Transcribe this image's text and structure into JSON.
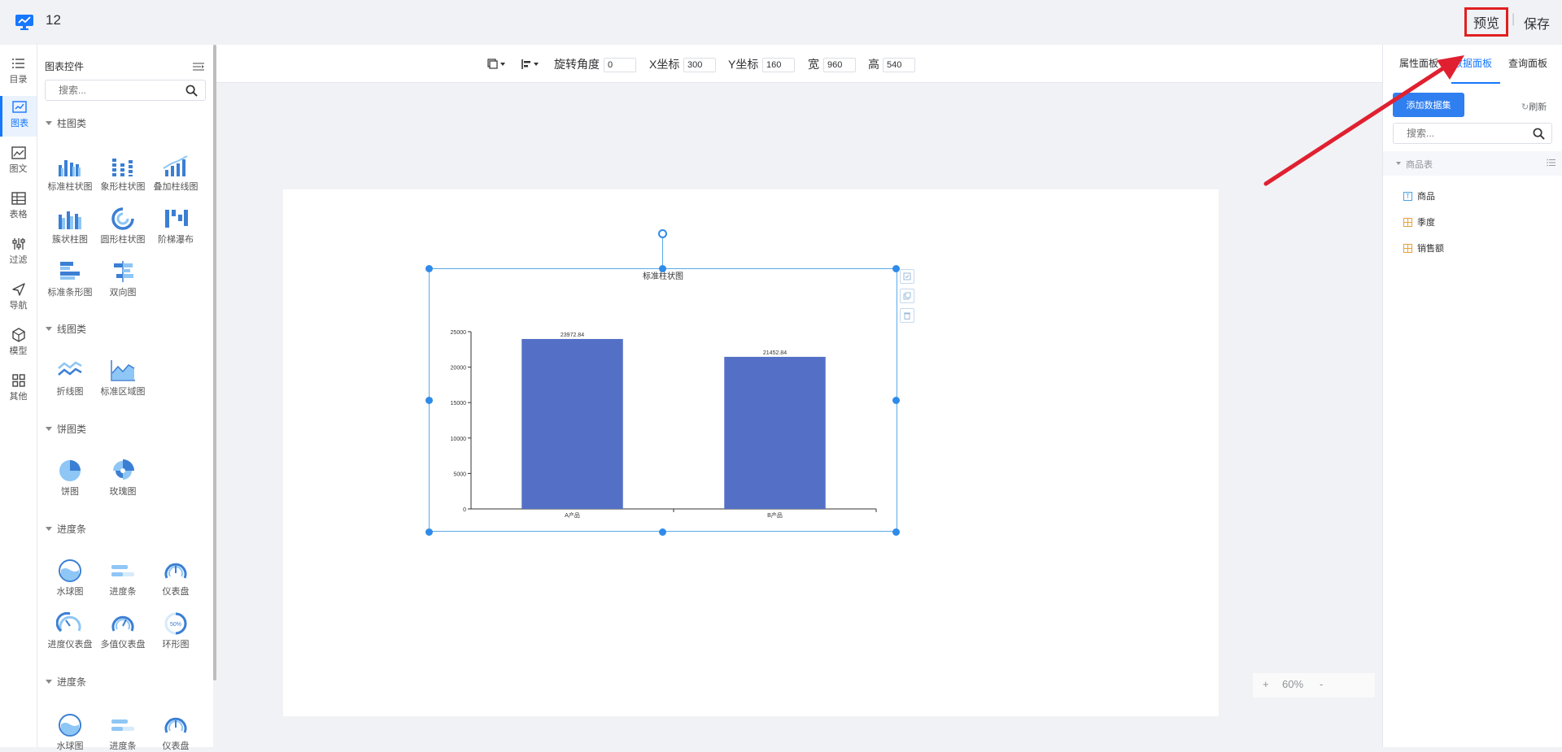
{
  "header": {
    "title": "12",
    "preview_label": "预览",
    "separator": "|",
    "save_label": "保存"
  },
  "rail": {
    "items": [
      {
        "label": "目录",
        "icon": "list-icon",
        "active": false
      },
      {
        "label": "图表",
        "icon": "chart-icon",
        "active": true
      },
      {
        "label": "图文",
        "icon": "image-text-icon",
        "active": false
      },
      {
        "label": "表格",
        "icon": "table-icon",
        "active": false
      },
      {
        "label": "过滤",
        "icon": "filter-icon",
        "active": false
      },
      {
        "label": "导航",
        "icon": "navigation-icon",
        "active": false
      },
      {
        "label": "模型",
        "icon": "model-icon",
        "active": false
      },
      {
        "label": "其他",
        "icon": "grid-icon",
        "active": false
      }
    ]
  },
  "components": {
    "title": "图表控件",
    "search_placeholder": "搜索...",
    "categories": [
      {
        "name": "柱图类",
        "items": [
          "标准柱状图",
          "象形柱状图",
          "叠加柱线图",
          "簇状柱图",
          "圆形柱状图",
          "阶梯瀑布",
          "标准条形图",
          "双向图"
        ]
      },
      {
        "name": "线图类",
        "items": [
          "折线图",
          "标准区域图"
        ]
      },
      {
        "name": "饼图类",
        "items": [
          "饼图",
          "玫瑰图"
        ]
      },
      {
        "name": "进度条",
        "items": [
          "水球图",
          "进度条",
          "仪表盘",
          "进度仪表盘",
          "多值仪表盘",
          "环形图"
        ]
      },
      {
        "name": "进度条",
        "items": [
          "水球图",
          "进度条",
          "仪表盘"
        ]
      }
    ],
    "ring_label": "50%"
  },
  "toolbar": {
    "rotation_label": "旋转角度",
    "rotation_value": "0",
    "x_label": "X坐标",
    "x_value": "300",
    "y_label": "Y坐标",
    "y_value": "160",
    "w_label": "宽",
    "w_value": "960",
    "h_label": "高",
    "h_value": "540"
  },
  "zoom": {
    "plus": "+",
    "level": "60%",
    "minus": "-"
  },
  "right_panel": {
    "tabs": [
      "属性面板",
      "数据面板",
      "查询面板"
    ],
    "active_tab": 1,
    "add_dataset_label": "添加数据集",
    "refresh_label": "刷新",
    "search_placeholder": "搜索...",
    "table_name": "商品表",
    "fields": [
      {
        "name": "商品",
        "type": "text"
      },
      {
        "name": "季度",
        "type": "number"
      },
      {
        "name": "销售额",
        "type": "number"
      }
    ]
  },
  "colors": {
    "accent": "#1677ff",
    "bar": "#5470c6",
    "highlight_red": "#e02020"
  },
  "chart_data": {
    "type": "bar",
    "title": "标准柱状图",
    "categories": [
      "A产品",
      "B产品"
    ],
    "values": [
      23972.84,
      21452.84
    ],
    "data_labels": [
      "23972.84",
      "21452.84"
    ],
    "ylim": [
      0,
      25000
    ],
    "yticks": [
      0,
      5000,
      10000,
      15000,
      20000,
      25000
    ],
    "xlabel": "",
    "ylabel": "",
    "grid": false
  }
}
